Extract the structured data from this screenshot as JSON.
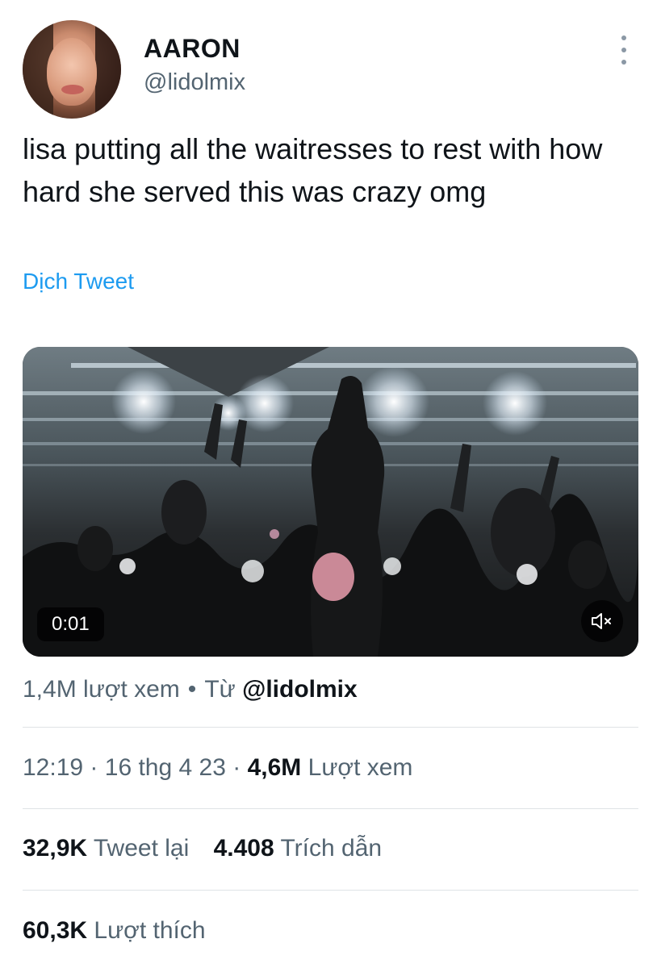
{
  "author": {
    "name": "AARON",
    "handle": "@lidolmix"
  },
  "tweet": {
    "text": "lisa putting all the waitresses to rest with how hard she served this was crazy omg",
    "translate_label": "Dịch Tweet"
  },
  "video": {
    "timestamp": "0:01",
    "mute_icon": "speaker-muted-icon"
  },
  "views": {
    "count": "1,4M lượt xem",
    "separator": "•",
    "from_label": "Từ",
    "from_handle": "@lidolmix"
  },
  "meta": {
    "time": "12:19",
    "dot1": "·",
    "date": "16 thg 4 23",
    "dot2": "·",
    "views_count": "4,6M",
    "views_label": "Lượt xem"
  },
  "stats": {
    "retweets_count": "32,9K",
    "retweets_label": "Tweet lại",
    "quotes_count": "4.408",
    "quotes_label": "Trích dẫn",
    "likes_count": "60,3K",
    "likes_label": "Lượt thích"
  },
  "colors": {
    "link": "#1d9bf0",
    "secondary_text": "#536471",
    "primary_text": "#0f1419"
  }
}
